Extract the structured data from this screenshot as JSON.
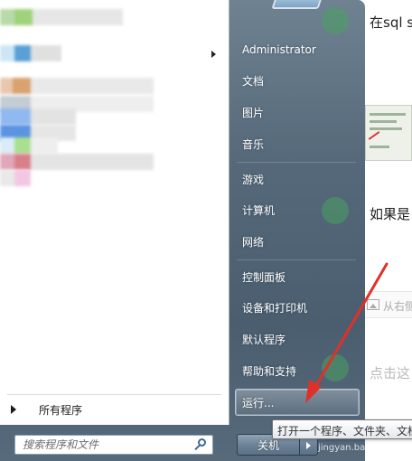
{
  "start_menu": {
    "user": "Administrator",
    "right_items": [
      {
        "label": "文档"
      },
      {
        "label": "图片"
      },
      {
        "label": "音乐"
      },
      {
        "label": "游戏"
      },
      {
        "label": "计算机"
      },
      {
        "label": "网络"
      },
      {
        "label": "控制面板"
      },
      {
        "label": "设备和打印机"
      },
      {
        "label": "默认程序"
      },
      {
        "label": "帮助和支持"
      }
    ],
    "run_label": "运行...",
    "all_programs_label": "所有程序",
    "search_placeholder": "搜索程序和文件",
    "shutdown_label": "关机",
    "tooltip_text": "打开一个程序、文件夹、文档"
  },
  "background_page": {
    "line_1": "在sql s",
    "line_2": "如果是",
    "image_caption": "从右侧",
    "line_3": "点击这"
  },
  "watermark": "jingyan.baidu.com",
  "colors": {
    "annotation_arrow": "#e0302a",
    "menu_pane": "#55697a"
  }
}
